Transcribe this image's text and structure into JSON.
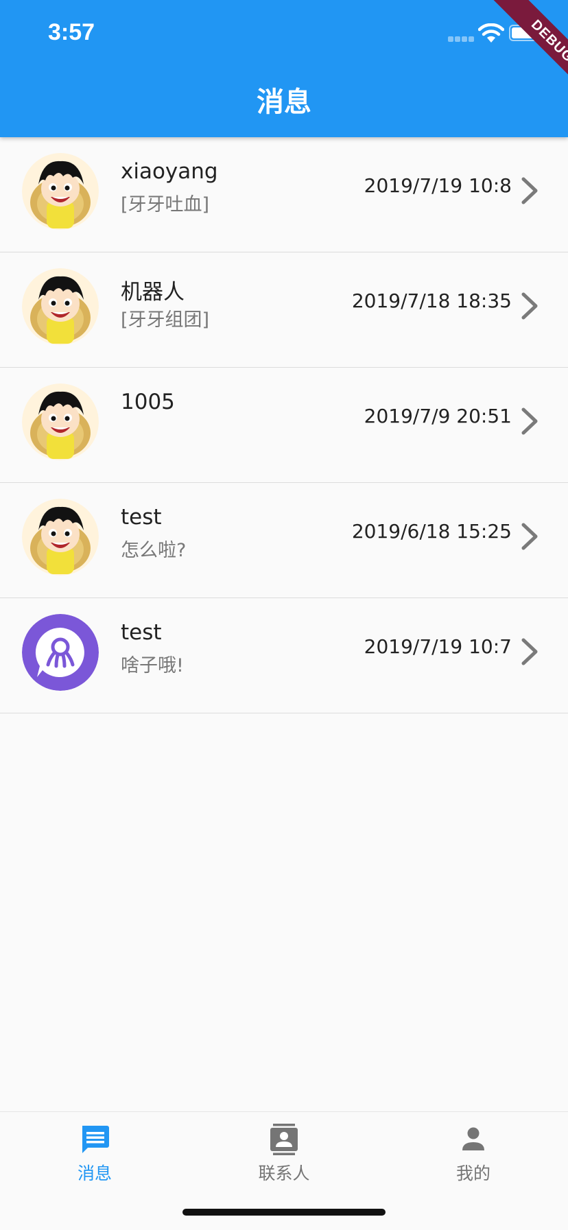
{
  "status_bar": {
    "time": "3:57"
  },
  "debug_label": "DEBUG",
  "app_bar": {
    "title": "消息"
  },
  "conversations": [
    {
      "name": "xiaoyang",
      "preview": "[牙牙吐血]",
      "time": "2019/7/19 10:8",
      "avatar": "luffy-avatar"
    },
    {
      "name": "机器人",
      "preview": "[牙牙组团]",
      "time": "2019/7/18 18:35",
      "avatar": "luffy-avatar"
    },
    {
      "name": "1005",
      "preview": "",
      "time": "2019/7/9 20:51",
      "avatar": "luffy-avatar"
    },
    {
      "name": "test",
      "preview": "怎么啦?",
      "time": "2019/6/18 15:25",
      "avatar": "luffy-avatar"
    },
    {
      "name": "test",
      "preview": "啥子哦!",
      "time": "2019/7/19 10:7",
      "avatar": "octopus-chat-avatar"
    }
  ],
  "bottom_nav": [
    {
      "label": "消息",
      "icon": "chat-icon",
      "active": true
    },
    {
      "label": "联系人",
      "icon": "contacts-icon",
      "active": false
    },
    {
      "label": "我的",
      "icon": "person-icon",
      "active": false
    }
  ],
  "colors": {
    "primary": "#2196f3",
    "inactive": "#757575",
    "avatar_purple": "#7b57d8",
    "debug_ribbon": "#7a1a3c"
  }
}
